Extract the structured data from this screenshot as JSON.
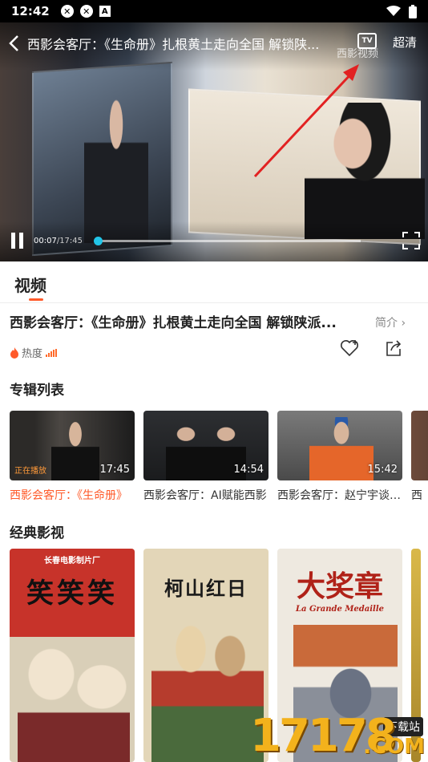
{
  "status_bar": {
    "time": "12:42",
    "icons": [
      "notification-icon",
      "notification-icon",
      "app-icon"
    ],
    "right_icons": [
      "wifi-icon",
      "battery-icon"
    ]
  },
  "player": {
    "title": "西影会客厅：《生命册》扎根黄土走向全国 解锁陕...",
    "quality": "超清",
    "tv_label": "TV",
    "watermark": "西影视频",
    "time_current": "00:07",
    "time_total": "/17:45",
    "progress_fraction": 0.0066,
    "accent_color": "#22c5e8"
  },
  "tabs": {
    "video": "视频"
  },
  "video_info": {
    "title": "西影会客厅：《生命册》扎根黄土走向全国 解锁陕派...",
    "intro": "简介 ›",
    "hot_label": "热度"
  },
  "album": {
    "heading": "专辑列表",
    "items": [
      {
        "title": "西影会客厅：《生命册》",
        "duration": "17:45",
        "badge": "正在播放",
        "active": true
      },
      {
        "title": "西影会客厅：AI赋能西影",
        "duration": "14:54"
      },
      {
        "title": "西影会客厅：赵宁宇谈电影",
        "duration": "15:42"
      },
      {
        "title": "西"
      }
    ]
  },
  "classic": {
    "heading": "经典影视",
    "posters": [
      {
        "title": "笑笑笑",
        "subtitle": "长春电影制片厂"
      },
      {
        "title": "柯山红日"
      },
      {
        "title": "大奖章",
        "subtitle": "La Grande Medaille"
      }
    ]
  },
  "watermark_site": {
    "number": "17178",
    "com": ".COM",
    "download": "下载站"
  }
}
